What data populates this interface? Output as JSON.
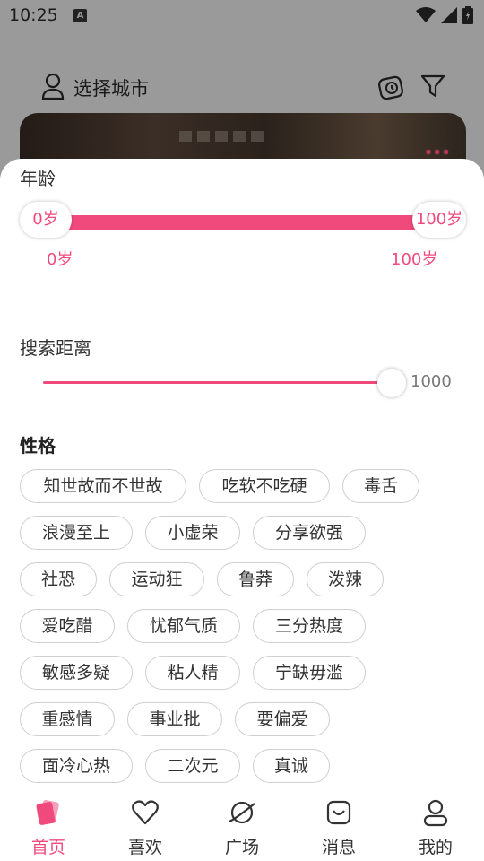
{
  "status": {
    "time": "10:25",
    "a_badge": "A"
  },
  "header": {
    "city_label": "选择城市"
  },
  "age": {
    "label": "年龄",
    "min_knob": "0岁",
    "max_knob": "100岁",
    "min_value": "0岁",
    "max_value": "100岁"
  },
  "distance": {
    "label": "搜索距离",
    "value": "1000",
    "fill_fraction": 1.0
  },
  "personality": {
    "title": "性格",
    "rows": [
      [
        "知世故而不世故",
        "吃软不吃硬",
        "毒舌"
      ],
      [
        "浪漫至上",
        "小虚荣",
        "分享欲强"
      ],
      [
        "社恐",
        "运动狂",
        "鲁莽",
        "泼辣"
      ],
      [
        "爱吃醋",
        "忧郁气质",
        "三分热度"
      ],
      [
        "敏感多疑",
        "粘人精",
        "宁缺毋滥"
      ],
      [
        "重感情",
        "事业批",
        "要偏爱"
      ],
      [
        "面冷心热",
        "二次元",
        "真诚"
      ]
    ]
  },
  "nav": {
    "items": [
      {
        "label": "首页",
        "icon": "cards-icon",
        "active": true
      },
      {
        "label": "喜欢",
        "icon": "heart-icon",
        "active": false
      },
      {
        "label": "广场",
        "icon": "planet-icon",
        "active": false
      },
      {
        "label": "消息",
        "icon": "message-bag-icon",
        "active": false
      },
      {
        "label": "我的",
        "icon": "user-icon",
        "active": false
      }
    ]
  },
  "colors": {
    "accent": "#f04a7c",
    "dim": "#9a9a9a"
  }
}
